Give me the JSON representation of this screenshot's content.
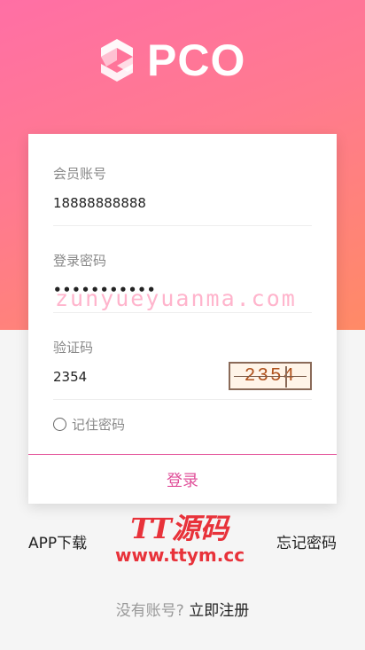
{
  "brand": {
    "name": "PCO",
    "logo_icon": "pco-cube-logo-icon"
  },
  "form": {
    "account": {
      "label": "会员账号",
      "value": "18888888888"
    },
    "password": {
      "label": "登录密码",
      "value": "•••••••••••"
    },
    "captcha": {
      "label": "验证码",
      "value": "2354",
      "image_text": "2354"
    },
    "remember": {
      "label": "记住密码",
      "checked": false
    },
    "submit_label": "登录"
  },
  "links": {
    "app_download": "APP下载",
    "forgot_password": "忘记密码"
  },
  "register": {
    "prompt": "没有账号?",
    "link": "立即注册"
  },
  "watermarks": {
    "top": "zunyueyuanma.com",
    "bottom_title": "TT源码",
    "bottom_url": "www.ttym.cc"
  },
  "colors": {
    "accent": "#e0509a",
    "gradient_start": "#ff6fa5",
    "gradient_end": "#ff8a66"
  }
}
